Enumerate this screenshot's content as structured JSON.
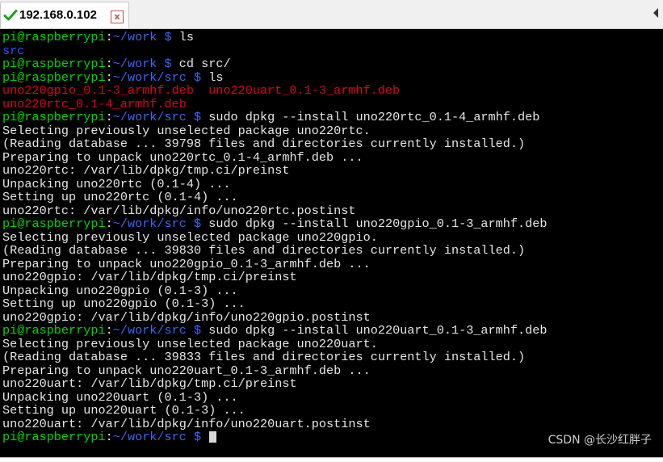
{
  "tab": {
    "title": "192.168.0.102",
    "close_glyph": "x",
    "status_icon": "check-icon",
    "status_color": "#1aa31a"
  },
  "terminal": {
    "colors": {
      "background": "#000000",
      "user_host": "#00d700",
      "path": "#3a64ff",
      "text": "#e6e6e6",
      "deb_file": "#e0001a"
    },
    "lines": [
      {
        "type": "prompt",
        "user": "pi@raspberrypi",
        "sep": ":",
        "path": "~/work",
        "symbol": " $ ",
        "cmd": "ls"
      },
      {
        "type": "dir",
        "text": "src"
      },
      {
        "type": "prompt",
        "user": "pi@raspberrypi",
        "sep": ":",
        "path": "~/work",
        "symbol": " $ ",
        "cmd": "cd src/"
      },
      {
        "type": "prompt",
        "user": "pi@raspberrypi",
        "sep": ":",
        "path": "~/work/src",
        "symbol": " $ ",
        "cmd": "ls"
      },
      {
        "type": "files",
        "text": "uno220gpio_0.1-3_armhf.deb  uno220uart_0.1-3_armhf.deb"
      },
      {
        "type": "files",
        "text": "uno220rtc_0.1-4_armhf.deb"
      },
      {
        "type": "prompt",
        "user": "pi@raspberrypi",
        "sep": ":",
        "path": "~/work/src",
        "symbol": " $ ",
        "cmd": "sudo dpkg --install uno220rtc_0.1-4_armhf.deb"
      },
      {
        "type": "out",
        "text": "Selecting previously unselected package uno220rtc."
      },
      {
        "type": "out",
        "text": "(Reading database ... 39798 files and directories currently installed.)"
      },
      {
        "type": "out",
        "text": "Preparing to unpack uno220rtc_0.1-4_armhf.deb ..."
      },
      {
        "type": "out",
        "text": "uno220rtc: /var/lib/dpkg/tmp.ci/preinst"
      },
      {
        "type": "out",
        "text": "Unpacking uno220rtc (0.1-4) ..."
      },
      {
        "type": "out",
        "text": "Setting up uno220rtc (0.1-4) ..."
      },
      {
        "type": "out",
        "text": "uno220rtc: /var/lib/dpkg/info/uno220rtc.postinst"
      },
      {
        "type": "prompt",
        "user": "pi@raspberrypi",
        "sep": ":",
        "path": "~/work/src",
        "symbol": " $ ",
        "cmd": "sudo dpkg --install uno220gpio_0.1-3_armhf.deb"
      },
      {
        "type": "out",
        "text": "Selecting previously unselected package uno220gpio."
      },
      {
        "type": "out",
        "text": "(Reading database ... 39830 files and directories currently installed.)"
      },
      {
        "type": "out",
        "text": "Preparing to unpack uno220gpio_0.1-3_armhf.deb ..."
      },
      {
        "type": "out",
        "text": "uno220gpio: /var/lib/dpkg/tmp.ci/preinst"
      },
      {
        "type": "out",
        "text": "Unpacking uno220gpio (0.1-3) ..."
      },
      {
        "type": "out",
        "text": "Setting up uno220gpio (0.1-3) ..."
      },
      {
        "type": "out",
        "text": "uno220gpio: /var/lib/dpkg/info/uno220gpio.postinst"
      },
      {
        "type": "prompt",
        "user": "pi@raspberrypi",
        "sep": ":",
        "path": "~/work/src",
        "symbol": " $ ",
        "cmd": "sudo dpkg --install uno220uart_0.1-3_armhf.deb"
      },
      {
        "type": "out",
        "text": "Selecting previously unselected package uno220uart."
      },
      {
        "type": "out",
        "text": "(Reading database ... 39833 files and directories currently installed.)"
      },
      {
        "type": "out",
        "text": "Preparing to unpack uno220uart_0.1-3_armhf.deb ..."
      },
      {
        "type": "out",
        "text": "uno220uart: /var/lib/dpkg/tmp.ci/preinst"
      },
      {
        "type": "out",
        "text": "Unpacking uno220uart (0.1-3) ..."
      },
      {
        "type": "out",
        "text": "Setting up uno220uart (0.1-3) ..."
      },
      {
        "type": "out",
        "text": "uno220uart: /var/lib/dpkg/info/uno220uart.postinst"
      },
      {
        "type": "prompt",
        "user": "pi@raspberrypi",
        "sep": ":",
        "path": "~/work/src",
        "symbol": " $ ",
        "cmd": ""
      }
    ]
  },
  "watermark": "CSDN @长沙红胖子"
}
